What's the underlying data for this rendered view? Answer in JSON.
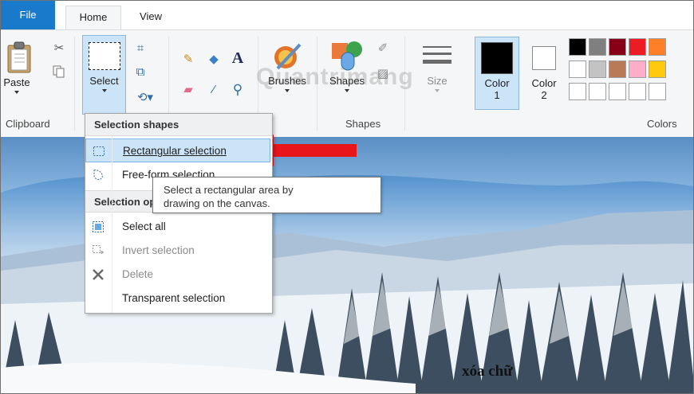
{
  "tabs": {
    "file": "File",
    "home": "Home",
    "view": "View"
  },
  "ribbon": {
    "clipboard": {
      "paste_label": "Paste",
      "group_label": "Clipboard"
    },
    "image": {
      "select_label": "Select"
    },
    "tools": {
      "text_glyph": "A"
    },
    "brushes_label": "Brushes",
    "shapes": {
      "shapes_label": "Shapes",
      "group_label": "Shapes"
    },
    "size_label": "Size",
    "colors": {
      "color1_label": "Color",
      "color1_num": "1",
      "color2_label": "Color",
      "color2_num": "2",
      "group_label": "Colors",
      "color1_value": "#000000",
      "color2_value": "#ffffff",
      "palette_row1": [
        "#000000",
        "#7f7f7f",
        "#880015",
        "#ed1c24",
        "#ff7f27"
      ],
      "palette_row2": [
        "#ffffff",
        "#c3c3c3",
        "#b97a57",
        "#ffaec9",
        "#ffc90e"
      ],
      "palette_row3": [
        "#ffffff",
        "#ffffff",
        "#ffffff",
        "#ffffff",
        "#ffffff"
      ]
    }
  },
  "watermark": "Quantrimang",
  "dropdown": {
    "header_shapes": "Selection shapes",
    "rect_selection": "Rectangular selection",
    "freeform_selection": "Free-form selection",
    "header_options": "Selection options",
    "select_all": "Select all",
    "invert_selection": "Invert selection",
    "delete": "Delete",
    "transparent_selection": "Transparent selection"
  },
  "tooltip": {
    "line1": "Select a rectangular area by",
    "line2": "drawing on the canvas."
  },
  "canvas": {
    "caption": "xóa chữ"
  },
  "colors": {
    "accent": "#1979ca",
    "highlight": "#cce4f7",
    "arrow": "#e8151b"
  }
}
